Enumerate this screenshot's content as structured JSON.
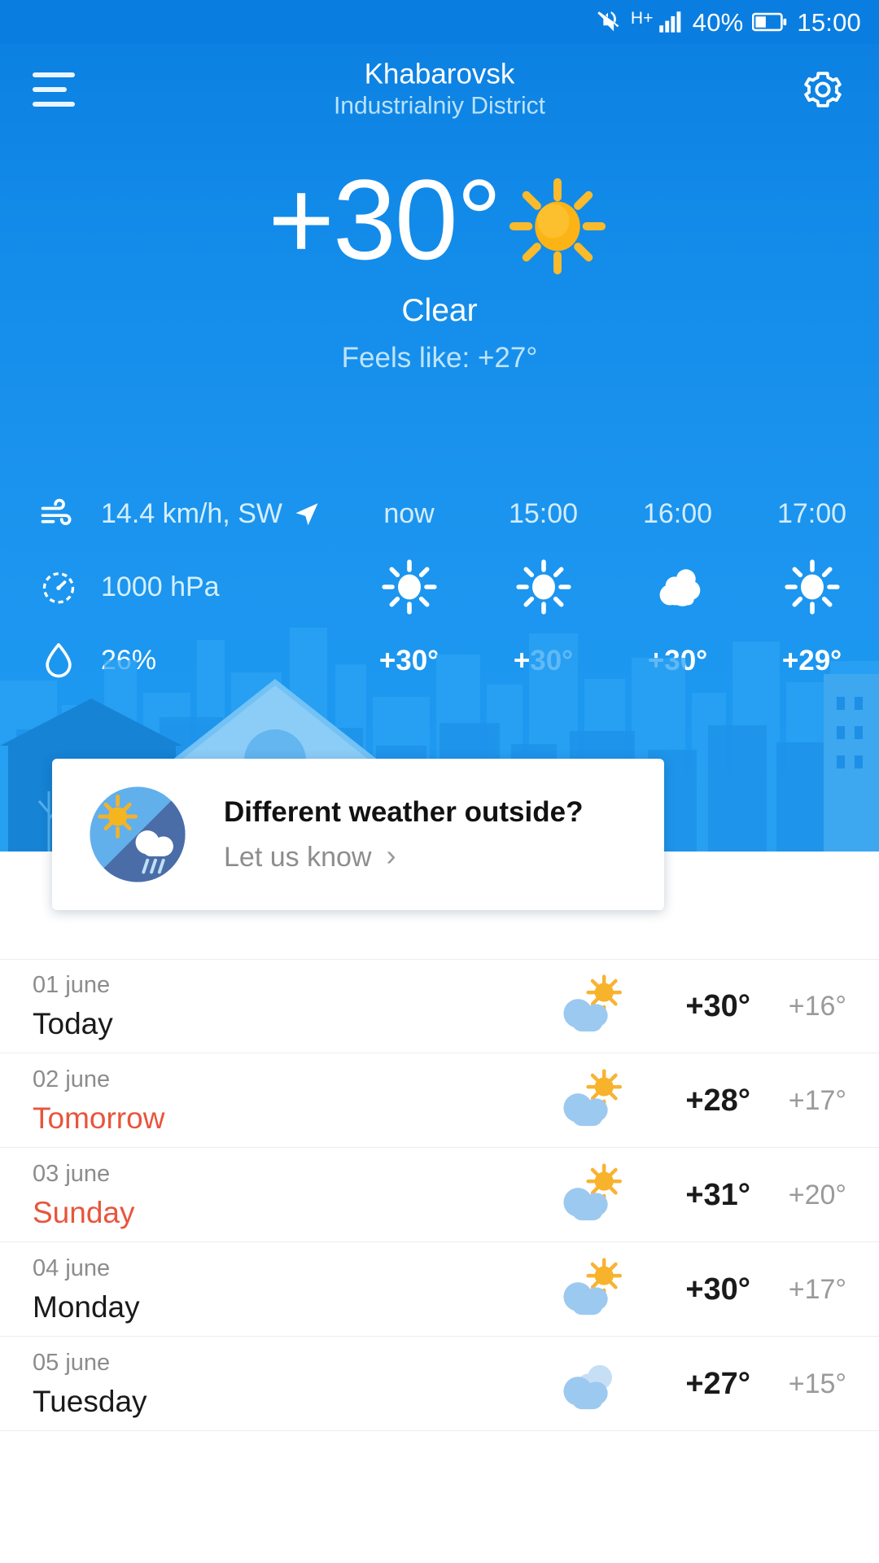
{
  "status_bar": {
    "mute_icon": "mute-icon",
    "network_type": "H+",
    "signal_icon": "signal-bars-icon",
    "battery_percent": "40%",
    "battery_icon": "battery-icon",
    "time": "15:00"
  },
  "header": {
    "menu_icon": "hamburger-menu-icon",
    "city": "Khabarovsk",
    "district": "Industrialniy District",
    "settings_icon": "gear-icon"
  },
  "current": {
    "temperature": "+30°",
    "condition_icon": "sun-icon",
    "condition": "Clear",
    "feels_like": "Feels like: +27°"
  },
  "metrics": [
    {
      "icon": "wind-icon",
      "value": "14.4 km/h, SW",
      "direction_icon": "wind-direction-arrow-icon"
    },
    {
      "icon": "pressure-gauge-icon",
      "value": "1000 hPa"
    },
    {
      "icon": "humidity-drop-icon",
      "value": "26%"
    }
  ],
  "hourly": {
    "labels": [
      "now",
      "15:00",
      "16:00",
      "17:00"
    ],
    "icons": [
      "sun-icon",
      "sun-icon",
      "cloudy-icon",
      "sun-icon"
    ],
    "temps": [
      "+30°",
      "+30°",
      "+30°",
      "+29°"
    ]
  },
  "feedback_card": {
    "icon": "sun-rain-split-icon",
    "title": "Different weather outside?",
    "action": "Let us know",
    "chevron": "chevron-right-icon"
  },
  "daily": [
    {
      "date": "01 june",
      "day": "Today",
      "weekend": false,
      "icon": "partly-sunny-icon",
      "high": "+30°",
      "low": "+16°"
    },
    {
      "date": "02 june",
      "day": "Tomorrow",
      "weekend": true,
      "icon": "partly-sunny-icon",
      "high": "+28°",
      "low": "+17°"
    },
    {
      "date": "03 june",
      "day": "Sunday",
      "weekend": true,
      "icon": "partly-sunny-icon",
      "high": "+31°",
      "low": "+20°"
    },
    {
      "date": "04 june",
      "day": "Monday",
      "weekend": false,
      "icon": "partly-sunny-icon",
      "high": "+30°",
      "low": "+17°"
    },
    {
      "date": "05 june",
      "day": "Tuesday",
      "weekend": false,
      "icon": "cloudy-icon",
      "high": "+27°",
      "low": "+15°"
    }
  ],
  "colors": {
    "sky_top": "#0a7ee0",
    "sky_bottom": "#1f9bf2",
    "accent_sun": "#f9b233",
    "weekend_text": "#e8553c",
    "card_bg": "#ffffff"
  }
}
